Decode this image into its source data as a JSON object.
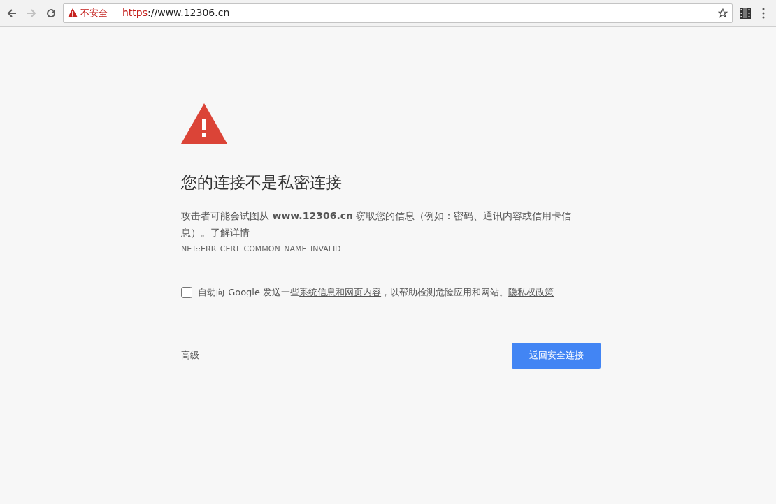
{
  "toolbar": {
    "back_disabled": false,
    "forward_disabled": true,
    "security_label": "不安全",
    "url_scheme": "https",
    "url_rest": "://www.12306.cn",
    "bookmarked": false
  },
  "page": {
    "heading": "您的连接不是私密连接",
    "description": "攻击者可能会试图从 **www.12306.cn** 窃取您的信息（例如：密码、通讯内容或信用卡信息）。",
    "learn_more_link": "了解详情",
    "error_code": "NET::ERR_CERT_COMMON_NAME_INVALID",
    "report_checkbox": {
      "checked": false,
      "text_before": "自动向 Google 发送一些",
      "link": "系统信息和网页内容",
      "text_after": "，以帮助检测危险应用和网站。",
      "privacy_link": "隐私权政策"
    },
    "advanced_button": "高级",
    "back_button": "返回安全连接"
  }
}
